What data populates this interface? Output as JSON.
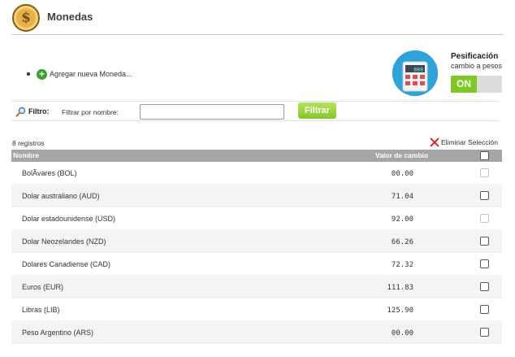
{
  "header": {
    "title": "Monedas",
    "coin_symbol": "$"
  },
  "add_currency": {
    "label": "Agregar nueva Moneda..."
  },
  "pesificacion": {
    "title": "Pesificación",
    "subtitle": "cambio a pesos",
    "toggle_label": "ON",
    "toggle_state": "on"
  },
  "calculator": {
    "display": "888"
  },
  "filter": {
    "label": "Filtro:",
    "name_label": "Filtrar por nombre:",
    "input_value": "",
    "button_label": "Filtrar"
  },
  "records": {
    "count_label": "8 registros",
    "delete_label": "Eliminar Selección"
  },
  "table": {
    "columns": {
      "name": "Nombre",
      "rate": "Valor de cambio"
    },
    "rows": [
      {
        "name": "BolÃvares (BOL)",
        "rate": "00.00",
        "checkbox_enabled": false
      },
      {
        "name": "Dolar australiano (AUD)",
        "rate": "71.04",
        "checkbox_enabled": true
      },
      {
        "name": "Dolar estadounidense (USD)",
        "rate": "92.00",
        "checkbox_enabled": false
      },
      {
        "name": "Dolar Neozelandes (NZD)",
        "rate": "66.26",
        "checkbox_enabled": true
      },
      {
        "name": "Dolares Canadiense (CAD)",
        "rate": "72.32",
        "checkbox_enabled": true
      },
      {
        "name": "Euros (EUR)",
        "rate": "111.83",
        "checkbox_enabled": true
      },
      {
        "name": "Libras (LIB)",
        "rate": "125.90",
        "checkbox_enabled": true
      },
      {
        "name": "Peso Argentino (ARS)",
        "rate": "00.00",
        "checkbox_enabled": true
      }
    ]
  },
  "colors": {
    "accent_green": "#86c52a",
    "header_gray": "#a6a6a6",
    "toggle_on": "#7fc725",
    "delete_red": "#d62a2a"
  },
  "icons": {
    "coin": "dollar-coin-icon",
    "add": "plus-circle-icon",
    "calculator": "calculator-icon",
    "search": "magnifier-icon",
    "delete": "x-icon"
  }
}
